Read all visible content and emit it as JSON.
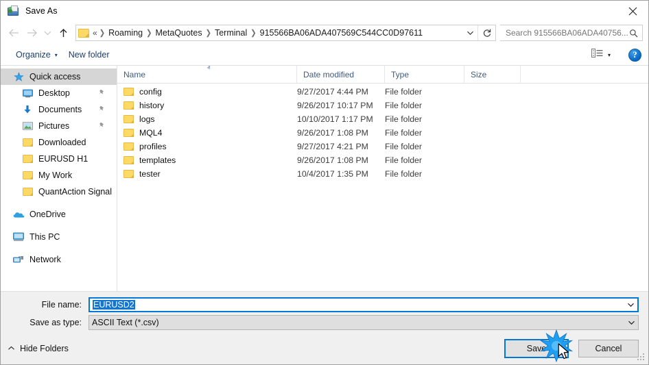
{
  "window": {
    "title": "Save As",
    "icon": "save-as-icon",
    "close_label": "✕"
  },
  "navigation": {
    "back": {
      "icon": "arrow-left-icon",
      "enabled": false
    },
    "forward": {
      "icon": "arrow-right-icon",
      "enabled": false
    },
    "recent": {
      "icon": "chevron-down-icon",
      "enabled": false
    },
    "up": {
      "icon": "arrow-up-icon",
      "enabled": true
    },
    "address": {
      "overflow": "«",
      "crumbs": [
        "Roaming",
        "MetaQuotes",
        "Terminal",
        "915566BA06ADA407569C544CC0D97611"
      ],
      "separator": "❯",
      "dropdown_icon": "chevron-down-icon",
      "refresh_icon": "refresh-icon"
    },
    "search": {
      "placeholder": "Search 915566BA06ADA40756...",
      "icon": "search-icon"
    }
  },
  "toolbar": {
    "organize_label": "Organize",
    "organize_caret": "▾",
    "new_folder_label": "New folder",
    "view_icon": "view-layout-icon",
    "view_caret": "▾",
    "help_label": "?"
  },
  "sidebar": {
    "items": [
      {
        "label": "Quick access",
        "icon": "star-icon",
        "level": 0,
        "selected": true,
        "pinned": false
      },
      {
        "label": "Desktop",
        "icon": "desktop-icon",
        "level": 1,
        "selected": false,
        "pinned": true
      },
      {
        "label": "Documents",
        "icon": "download-arrow-icon",
        "level": 1,
        "selected": false,
        "pinned": true
      },
      {
        "label": "Pictures",
        "icon": "picture-icon",
        "level": 1,
        "selected": false,
        "pinned": true
      },
      {
        "label": "Downloaded",
        "icon": "folder-icon",
        "level": 1,
        "selected": false,
        "pinned": false
      },
      {
        "label": "EURUSD H1",
        "icon": "folder-icon",
        "level": 1,
        "selected": false,
        "pinned": false
      },
      {
        "label": "My Work",
        "icon": "folder-icon",
        "level": 1,
        "selected": false,
        "pinned": false
      },
      {
        "label": "QuantAction Signal",
        "icon": "folder-icon",
        "level": 1,
        "selected": false,
        "pinned": false
      },
      {
        "label": "OneDrive",
        "icon": "cloud-icon",
        "level": 0,
        "selected": false,
        "pinned": false,
        "gap_before": true
      },
      {
        "label": "This PC",
        "icon": "computer-icon",
        "level": 0,
        "selected": false,
        "pinned": false,
        "gap_before": true
      },
      {
        "label": "Network",
        "icon": "network-icon",
        "level": 0,
        "selected": false,
        "pinned": false,
        "gap_before": true
      }
    ],
    "pin_glyph": "📌"
  },
  "file_list": {
    "columns": [
      "Name",
      "Date modified",
      "Type",
      "Size"
    ],
    "sort_column": "Name",
    "sort_direction": "ascending",
    "sort_caret": "ⱏ",
    "rows": [
      {
        "name": "config",
        "date": "9/27/2017 4:44 PM",
        "type": "File folder",
        "size": ""
      },
      {
        "name": "history",
        "date": "9/26/2017 10:17 PM",
        "type": "File folder",
        "size": ""
      },
      {
        "name": "logs",
        "date": "10/10/2017 1:17 PM",
        "type": "File folder",
        "size": ""
      },
      {
        "name": "MQL4",
        "date": "9/26/2017 1:08 PM",
        "type": "File folder",
        "size": ""
      },
      {
        "name": "profiles",
        "date": "9/27/2017 4:21 PM",
        "type": "File folder",
        "size": ""
      },
      {
        "name": "templates",
        "date": "9/26/2017 1:08 PM",
        "type": "File folder",
        "size": ""
      },
      {
        "name": "tester",
        "date": "10/4/2017 1:35 PM",
        "type": "File folder",
        "size": ""
      }
    ]
  },
  "form": {
    "file_name_label": "File name:",
    "file_name_value": "EURUSD2",
    "file_name_selected": true,
    "save_type_label": "Save as type:",
    "save_type_value": "ASCII Text (*.csv)",
    "dropdown_icon": "chevron-down-icon"
  },
  "footer": {
    "hide_folders_label": "Hide Folders",
    "hide_folders_caret": "ⱏ",
    "save_label": "Save",
    "cancel_label": "Cancel",
    "resize_grip": "resize-grip-icon"
  },
  "pointer": {
    "click_burst": "click-burst-icon",
    "cursor": "mouse-cursor-icon",
    "target": "save-button"
  },
  "colors": {
    "accent": "#0078d7",
    "selection": "#1475d1",
    "folder": "#ffd966",
    "sidebar_selection": "#d6d6d6",
    "column_header_text": "#3d5a80",
    "burst": "#1e9ff2"
  }
}
